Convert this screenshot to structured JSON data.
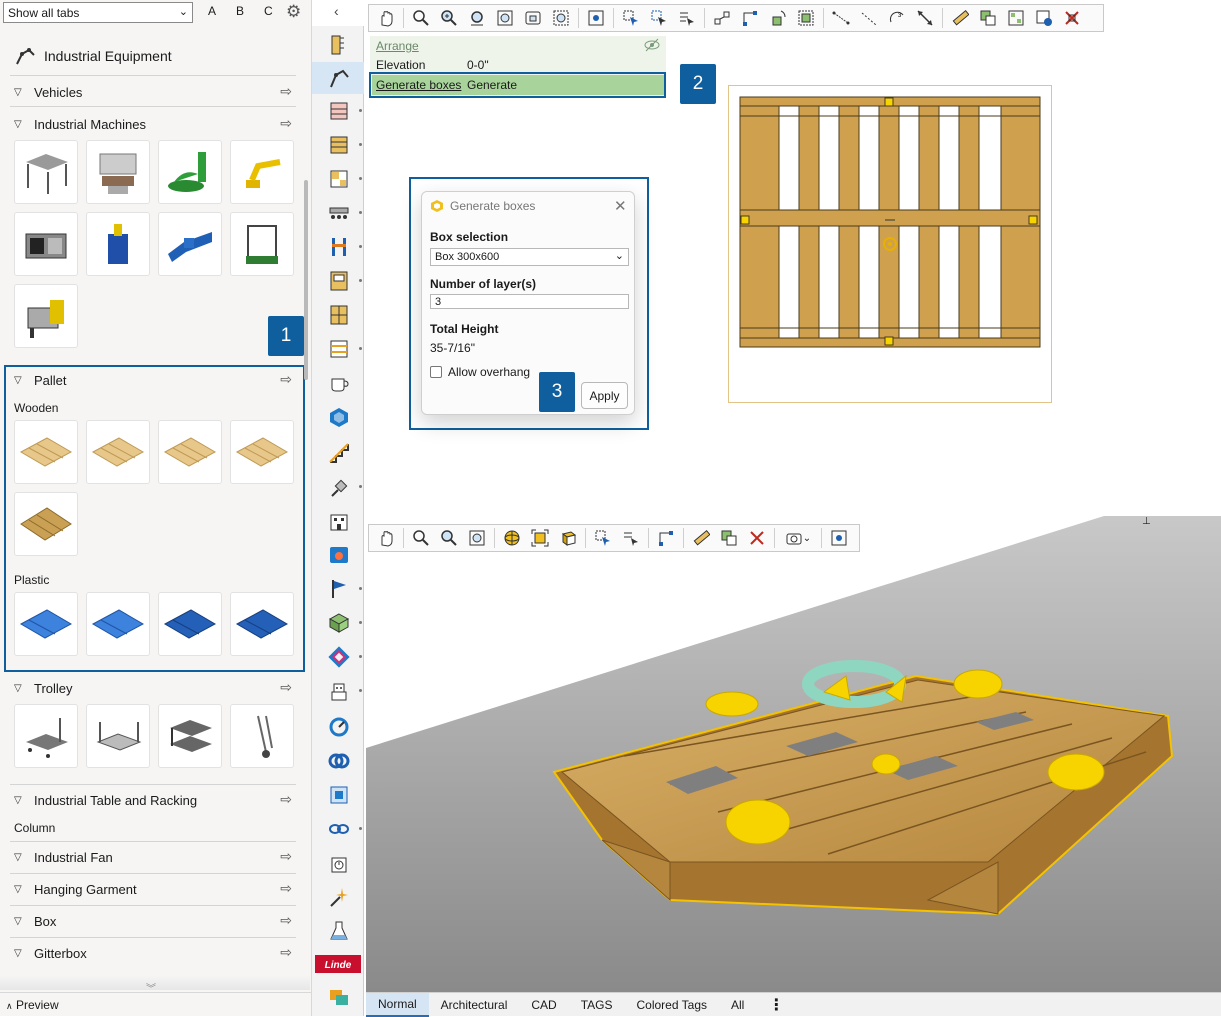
{
  "library": {
    "filter_select": "Show all tabs",
    "letters": [
      "A",
      "B",
      "C"
    ],
    "category_title": "Industrial Equipment",
    "sections": {
      "vehicles": "Vehicles",
      "machines": "Industrial Machines",
      "pallet": "Pallet",
      "trolley": "Trolley",
      "table_racking": "Industrial Table and Racking",
      "fan": "Industrial Fan",
      "garment": "Hanging Garment",
      "box": "Box",
      "gitterbox": "Gitterbox"
    },
    "sub_labels": {
      "wooden": "Wooden",
      "plastic": "Plastic",
      "column": "Column"
    },
    "preview_label": "Preview"
  },
  "badges": [
    "1",
    "2",
    "3"
  ],
  "properties": {
    "arrange": "Arrange",
    "elevation_label": "Elevation",
    "elevation_value": "0-0\"",
    "generate_label": "Generate boxes",
    "generate_value": "Generate"
  },
  "dialog": {
    "title": "Generate boxes",
    "box_selection_label": "Box selection",
    "box_selection_value": "Box 300x600",
    "layers_label": "Number of layer(s)",
    "layers_value": "3",
    "total_height_label": "Total Height",
    "total_height_value": "35-7/16\"",
    "overhang_label": "Allow overhang",
    "apply_label": "Apply"
  },
  "view_tabs": [
    "Normal",
    "Architectural",
    "CAD",
    "TAGS",
    "Colored Tags",
    "All"
  ],
  "colors": {
    "highlight": "#0f5f9e",
    "wood": "#c8a050",
    "handle_yellow": "#f0d000",
    "plastic_blue": "#2a6fc9"
  }
}
